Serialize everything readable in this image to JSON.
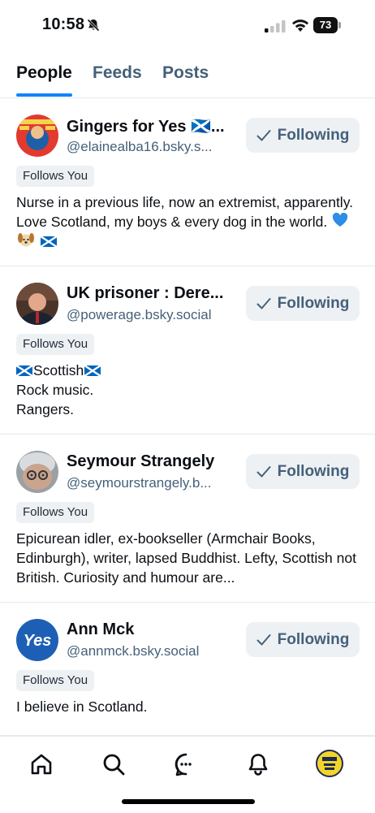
{
  "status": {
    "time": "10:58",
    "battery": "73"
  },
  "tabs": [
    {
      "label": "People"
    },
    {
      "label": "Feeds"
    },
    {
      "label": "Posts"
    }
  ],
  "people": [
    {
      "name": "Gingers for Yes 🏴󠁧󠁢󠁳󠁣󠁴󠁿...",
      "handle": "@elainealba16.bsky.s...",
      "follow_label": "Following",
      "badge": "Follows You",
      "bio": "Nurse in a previous life, now an extremist, apparently. Love Scotland, my boys & every dog in the world.",
      "avatar_color": "#d7352b"
    },
    {
      "name": "UK prisoner : Dere...",
      "handle": "@powerage.bsky.social",
      "follow_label": "Following",
      "badge": "Follows You",
      "bio_line1": "Scottish",
      "bio_line2": "Rock music.",
      "bio_line3": "Rangers.",
      "avatar_color": "#3b2a22"
    },
    {
      "name": "Seymour Strangely",
      "handle": "@seymourstrangely.b...",
      "follow_label": "Following",
      "badge": "Follows You",
      "bio": "Epicurean idler, ex-bookseller (Armchair Books, Edinburgh), writer, lapsed Buddhist. Lefty, Scottish not British. Curiosity and humour are...",
      "avatar_color": "#8a8f94"
    },
    {
      "name": "Ann Mck",
      "handle": "@annmck.bsky.social",
      "follow_label": "Following",
      "badge": "Follows You",
      "bio": "I believe in Scotland.",
      "avatar_text": "Yes",
      "avatar_color": "#1d5fb5"
    }
  ],
  "nav": [
    {
      "icon": "home-icon"
    },
    {
      "icon": "search-icon"
    },
    {
      "icon": "chat-icon"
    },
    {
      "icon": "bell-icon"
    },
    {
      "icon": "profile-avatar"
    }
  ],
  "colors": {
    "accent": "#1083fe",
    "muted": "#45607a",
    "chip": "#eef1f4"
  }
}
